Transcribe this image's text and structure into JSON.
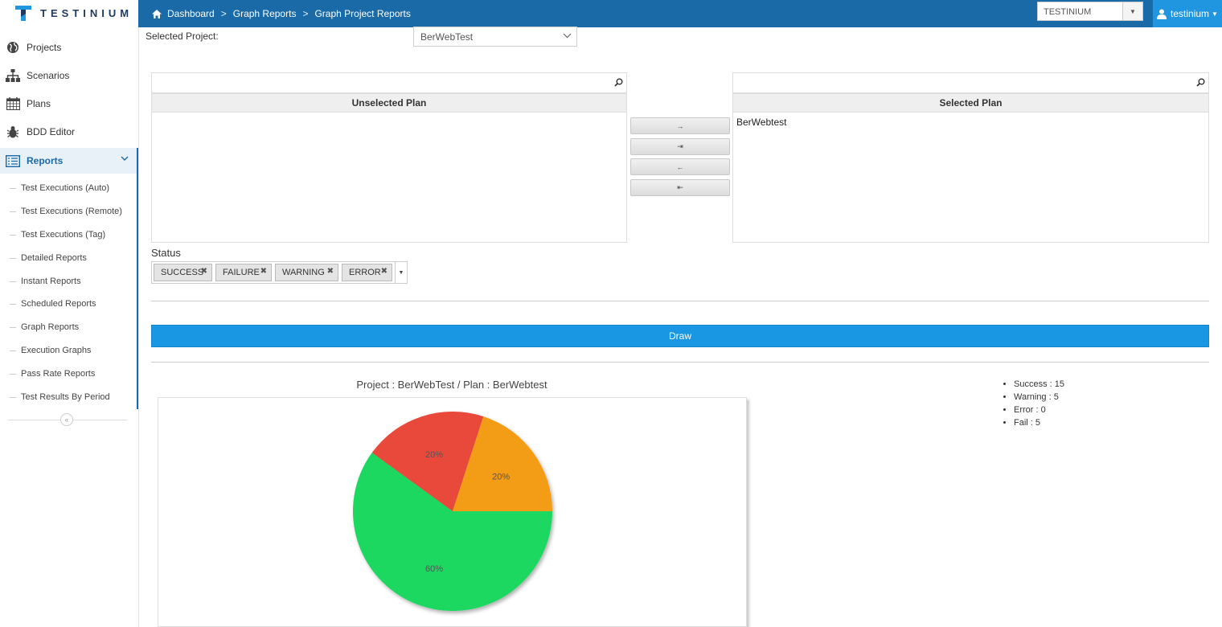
{
  "header": {
    "logo_text": "TESTINIUM",
    "breadcrumbs": [
      "Dashboard",
      "Graph Reports",
      "Graph Project Reports"
    ],
    "org_select": "TESTINIUM",
    "user": "testinium"
  },
  "sidebar": {
    "items": [
      {
        "label": "Projects"
      },
      {
        "label": "Scenarios"
      },
      {
        "label": "Plans"
      },
      {
        "label": "BDD Editor"
      },
      {
        "label": "Reports"
      }
    ],
    "reports_sub": [
      "Test Executions (Auto)",
      "Test Executions (Remote)",
      "Test Executions (Tag)",
      "Detailed Reports",
      "Instant Reports",
      "Scheduled Reports",
      "Graph Reports",
      "Execution Graphs",
      "Pass Rate Reports",
      "Test Results By Period"
    ]
  },
  "form": {
    "selected_project_label": "Selected Project:",
    "selected_project_value": "BerWebTest",
    "unselected_header": "Unselected Plan",
    "selected_header": "Selected Plan",
    "selected_plans": [
      "BerWebtest"
    ],
    "move_buttons": [
      "→",
      "⇥",
      "←",
      "⇤"
    ],
    "status_label": "Status",
    "status_chips": [
      "SUCCESS",
      "FAILURE",
      "WARNING",
      "ERROR"
    ],
    "draw_label": "Draw"
  },
  "chart_data": {
    "type": "pie",
    "title": "Project : BerWebTest / Plan : BerWebtest",
    "slices": [
      {
        "label": "Success",
        "value": 15,
        "percent_label": "60%",
        "color": "#1fd760"
      },
      {
        "label": "Fail",
        "value": 5,
        "percent_label": "20%",
        "color": "#e8493a"
      },
      {
        "label": "Warning",
        "value": 5,
        "percent_label": "20%",
        "color": "#f39c12"
      },
      {
        "label": "Error",
        "value": 0,
        "percent_label": "0%",
        "color": "#999999"
      }
    ],
    "legend": [
      "Success : 15",
      "Warning : 5",
      "Error : 0",
      "Fail : 5"
    ]
  }
}
